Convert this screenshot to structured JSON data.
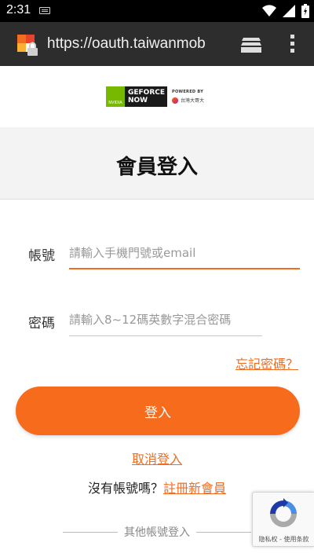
{
  "status_bar": {
    "time": "2:31"
  },
  "browser": {
    "url": "https://oauth.taiwanmob"
  },
  "logo": {
    "nvidia_text": "NVIDIA",
    "product_line1": "GEFORCE",
    "product_line2": "NOW",
    "powered_by": "POWERED BY",
    "brand": "台灣大哥大"
  },
  "page": {
    "title": "會員登入"
  },
  "form": {
    "account_label": "帳號",
    "account_placeholder": "請輸入手機門號或email",
    "password_label": "密碼",
    "password_placeholder": "請輸入8~12碼英數字混合密碼",
    "forgot_link": "忘記密碼？",
    "login_button": "登入",
    "cancel_link": "取消登入",
    "no_account_text": "沒有帳號嗎？",
    "register_link": "註冊新會員",
    "other_login": "其他帳號登入"
  },
  "recaptcha": {
    "text": "隐私权 - 使用条款"
  },
  "colors": {
    "accent": "#f76b1c",
    "link": "#f36d21",
    "nvidia_green": "#76b900"
  }
}
